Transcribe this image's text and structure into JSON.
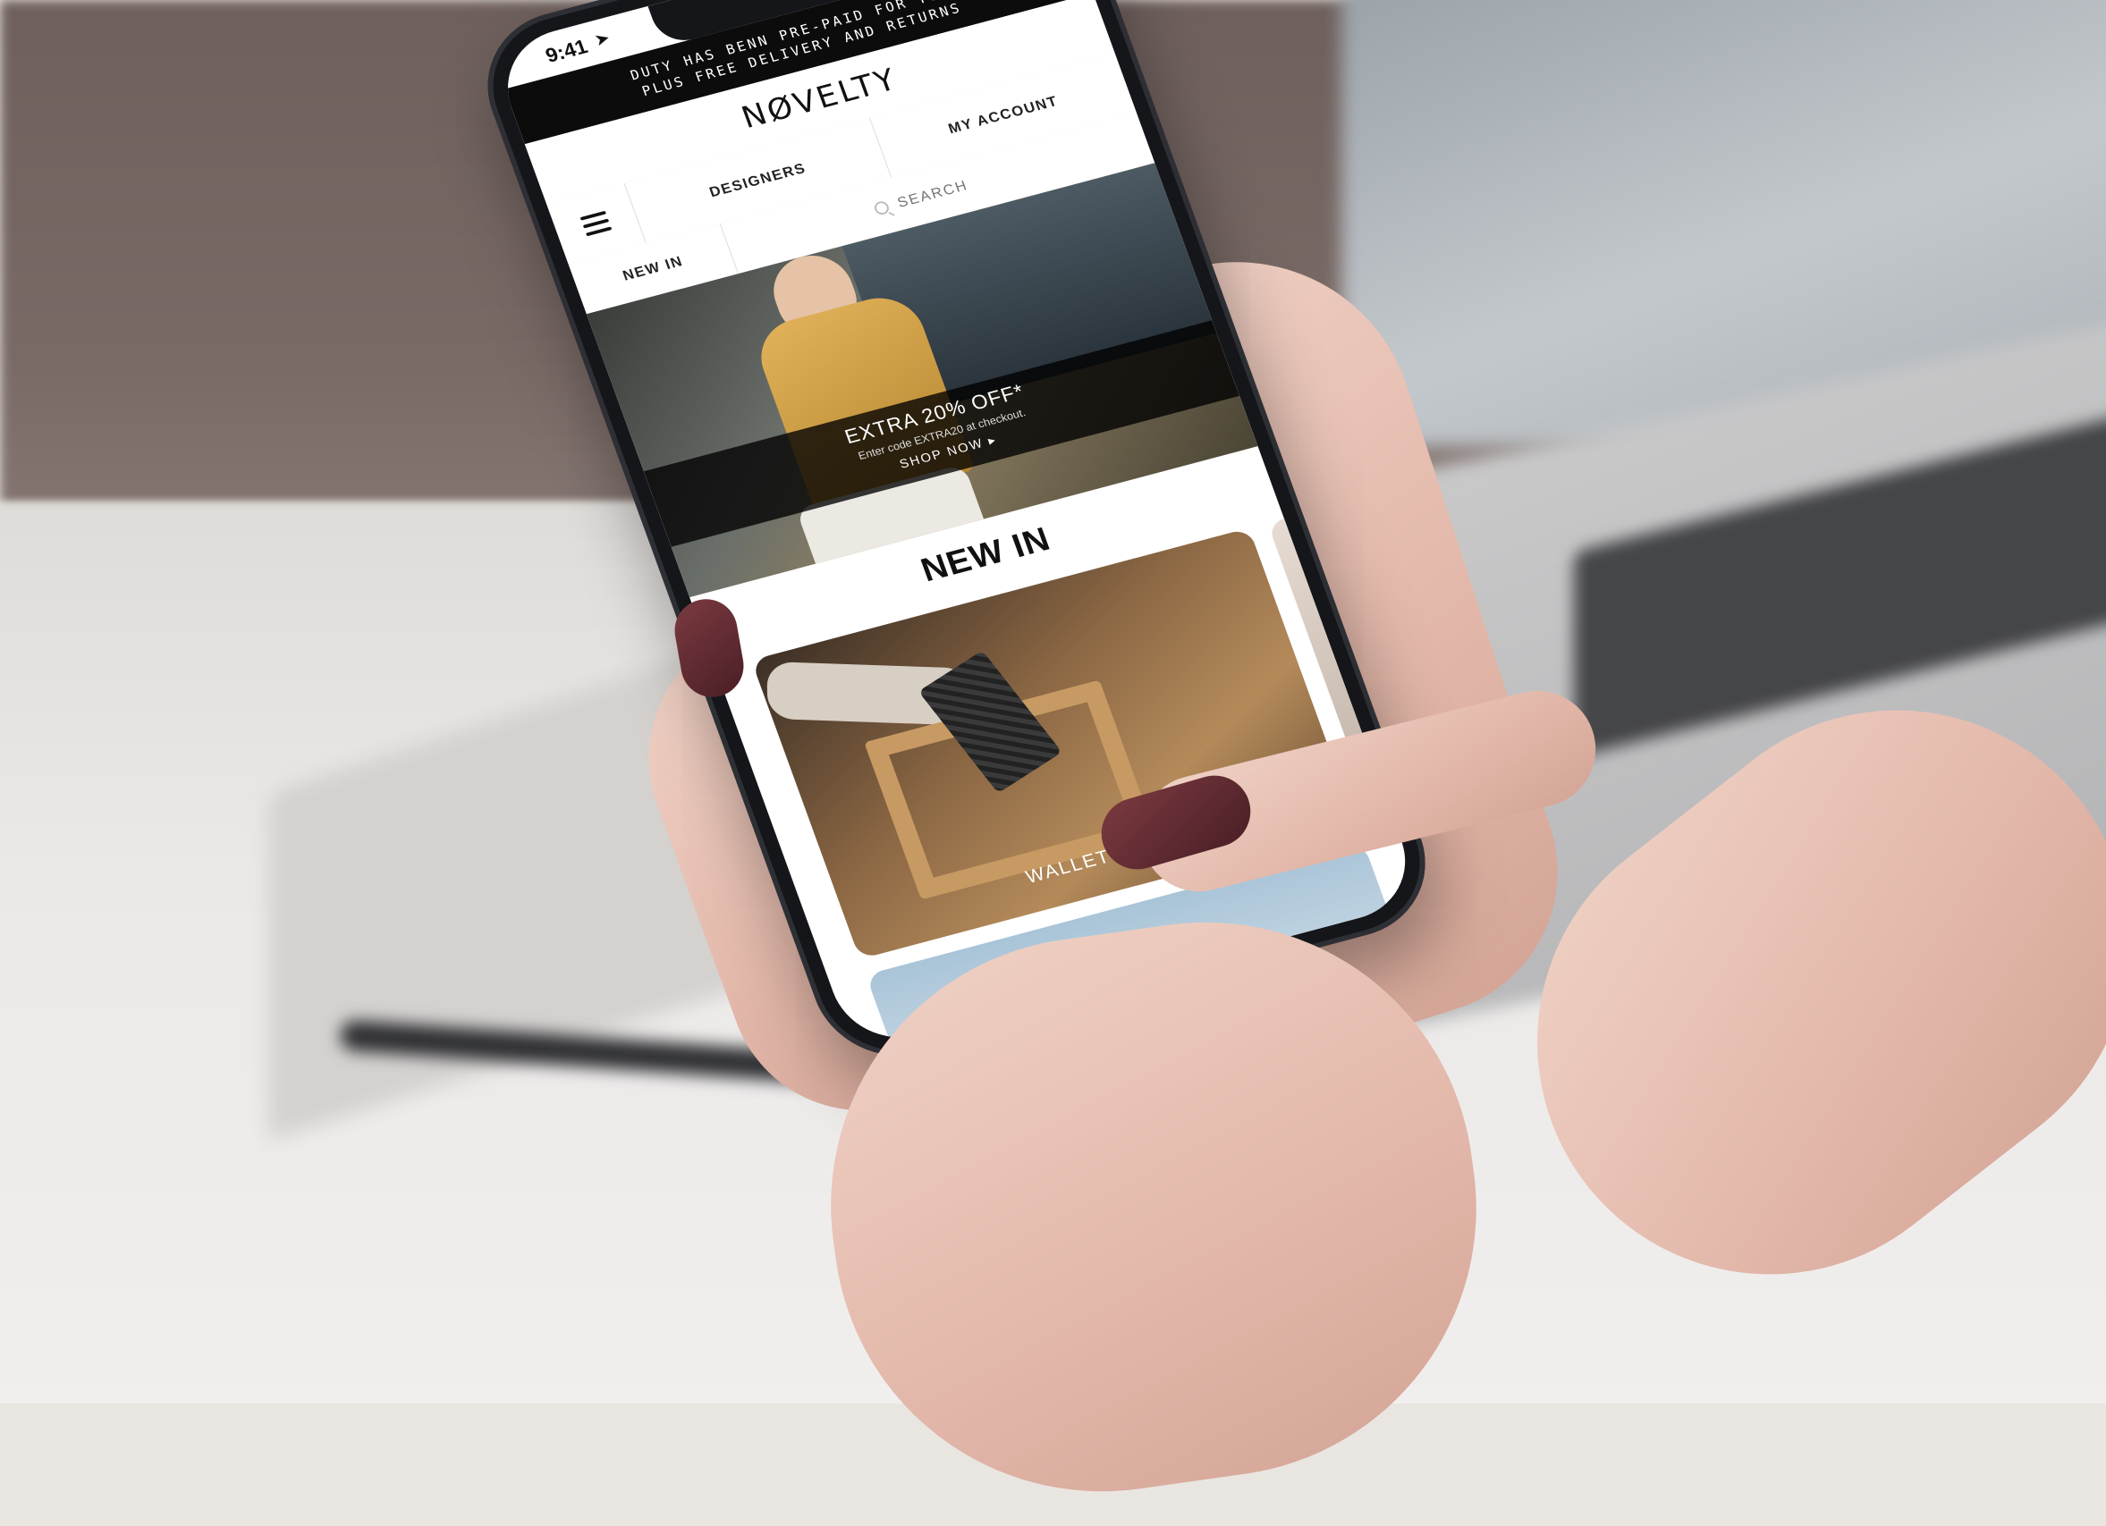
{
  "status_bar": {
    "time": "9:41",
    "location_glyph": "➤",
    "wifi_glyph": "◠"
  },
  "promo_bar": {
    "line1": "DUTY HAS BENN PRE-PAID FOR YOU,",
    "line2": "PLUS FREE DELIVERY AND RETURNS"
  },
  "header": {
    "logo": "NØVELTY"
  },
  "nav": {
    "items": [
      {
        "label": "DESIGNERS"
      },
      {
        "label": "MY ACCOUNT"
      }
    ]
  },
  "sub_nav": {
    "new_in_label": "NEW IN",
    "search_placeholder": "SEARCH"
  },
  "hero": {
    "offer": "EXTRA 20% OFF*",
    "code_text": "Enter code EXTRA20 at checkout.",
    "cta": "SHOP NOW ▸"
  },
  "section": {
    "title": "NEW IN"
  },
  "cards": [
    {
      "label": "WALLET PICK"
    }
  ],
  "icons": {
    "menu": "hamburger-icon",
    "bag": "shopping-bag-icon",
    "search": "search-icon",
    "battery": "battery-icon",
    "wifi": "wifi-icon",
    "signal": "signal-icon",
    "location": "location-arrow-icon"
  },
  "colors": {
    "promo_bg": "#0c0c0c",
    "screen_bg": "#ffffff",
    "nail_polish": "#5a2a30"
  }
}
